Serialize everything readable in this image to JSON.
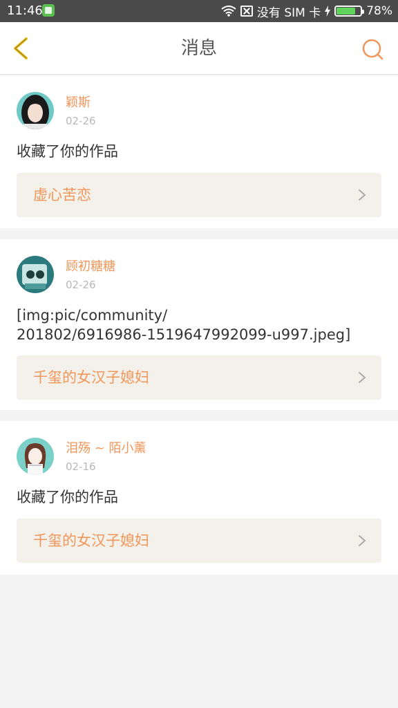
{
  "status_bar": {
    "time": "11:46",
    "carrier": "没有 SIM 卡",
    "battery": "78%",
    "battery_level": 0.78
  },
  "nav": {
    "title": "消息",
    "back_icon": "chevron-left-icon",
    "search_icon": "search-icon",
    "accent_color": "#f0965a"
  },
  "messages": [
    {
      "username": "颖斯",
      "date": "02-26",
      "body": "收藏了你的作品",
      "work_title": "虚心苦恋"
    },
    {
      "username": "顾初糖糖",
      "date": "02-26",
      "body": "[img:pic/community/\n201802/6916986-1519647992099-u997.jpeg]",
      "work_title": "千玺的女汉子媳妇"
    },
    {
      "username": "泪殇 ~ 陌小薰",
      "date": "02-16",
      "body": "收藏了你的作品",
      "work_title": "千玺的女汉子媳妇"
    }
  ]
}
